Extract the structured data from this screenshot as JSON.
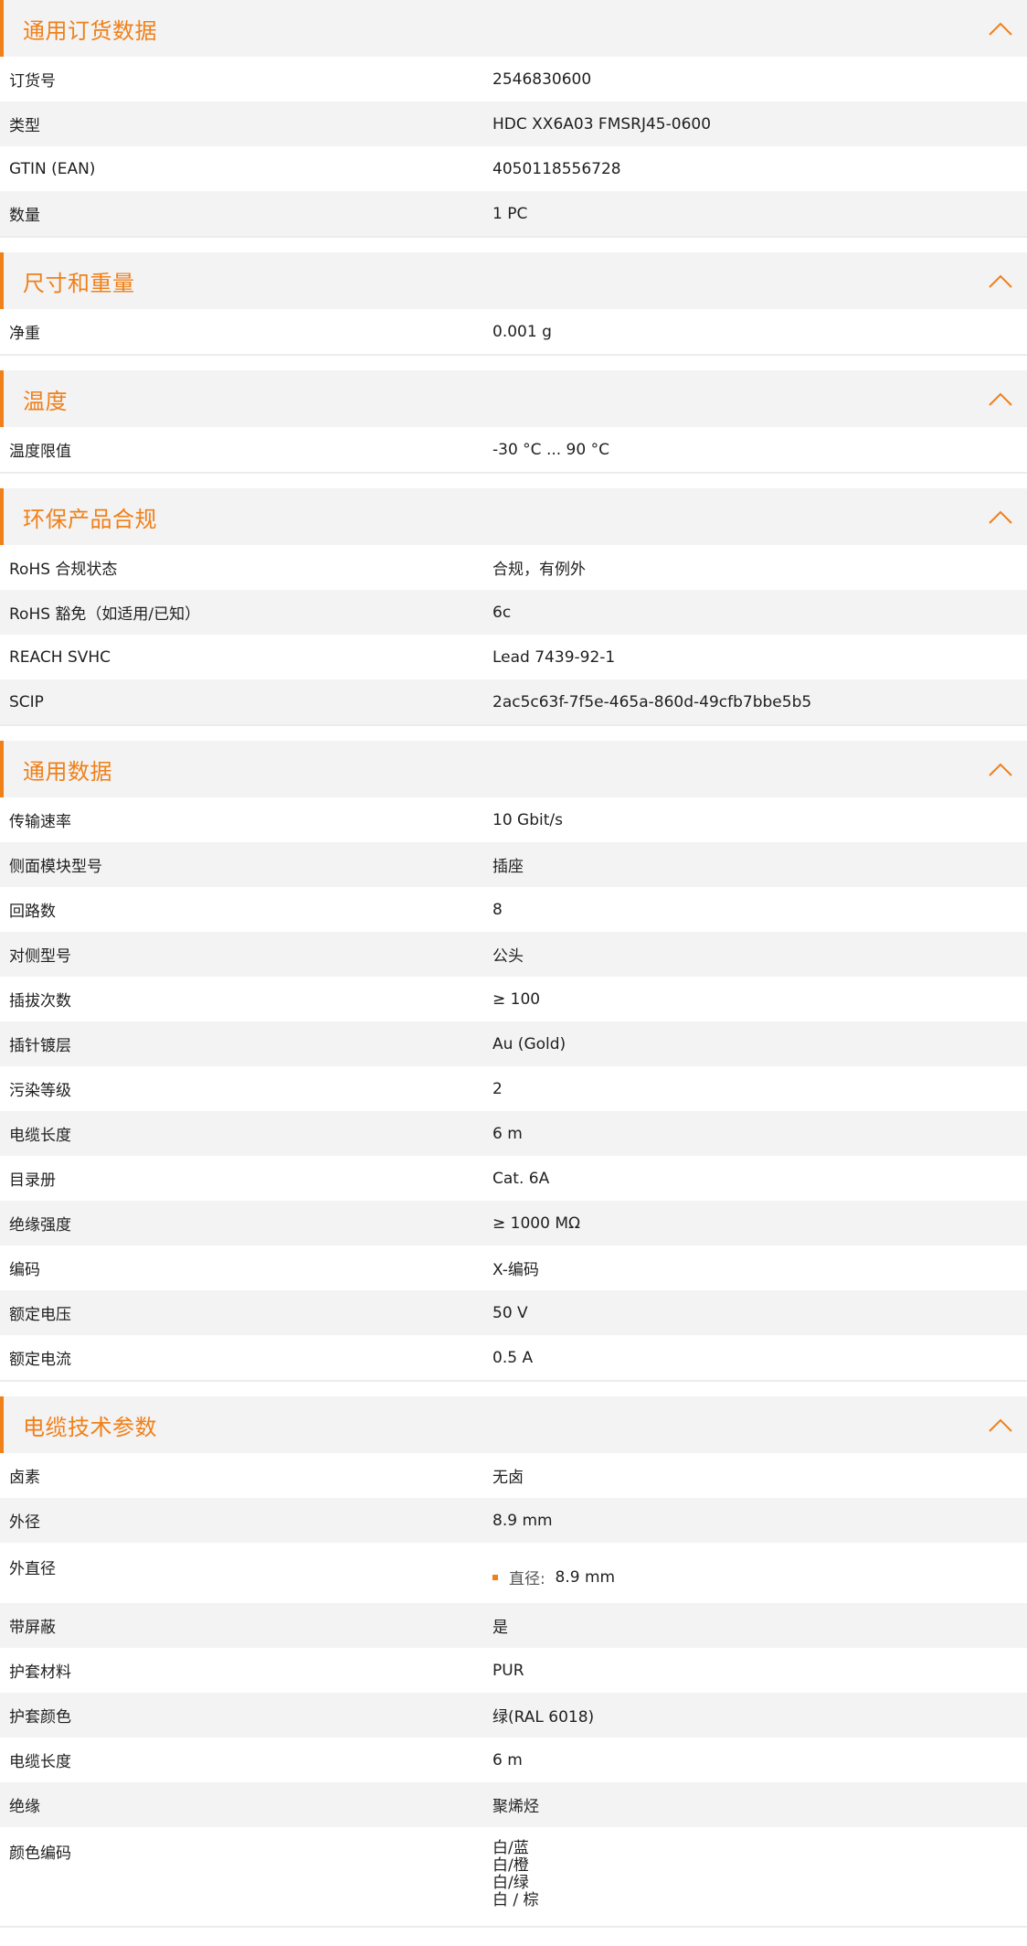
{
  "colors": {
    "accent": "#f08019",
    "header_bg": "#f3f3f4",
    "alt_row_bg": "#f3f3f4"
  },
  "icons": {
    "collapse": "chevron-up-icon",
    "list_bullet": "square-bullet-icon"
  },
  "sections": [
    {
      "title": "通用订货数据",
      "rows": [
        {
          "k": "订货号",
          "v": "2546830600"
        },
        {
          "k": "类型",
          "v": "HDC XX6A03 FMSRJ45-0600"
        },
        {
          "k": "GTIN (EAN)",
          "v": "4050118556728"
        },
        {
          "k": "数量",
          "v": "1  PC"
        }
      ]
    },
    {
      "title": "尺寸和重量",
      "rows": [
        {
          "k": "净重",
          "v": "0.001  g"
        }
      ]
    },
    {
      "title": "温度",
      "rows": [
        {
          "k": "温度限值",
          "v": "-30 °C ... 90 °C"
        }
      ]
    },
    {
      "title": "环保产品合规",
      "rows": [
        {
          "k": "RoHS 合规状态",
          "v": "合规，有例外"
        },
        {
          "k": "RoHS 豁免（如适用/已知）",
          "v": "6c"
        },
        {
          "k": "REACH SVHC",
          "v": "Lead 7439-92-1"
        },
        {
          "k": "SCIP",
          "v": "2ac5c63f-7f5e-465a-860d-49cfb7bbe5b5"
        }
      ]
    },
    {
      "title": "通用数据",
      "rows": [
        {
          "k": "传输速率",
          "v": "10 Gbit/s"
        },
        {
          "k": "侧面模块型号",
          "v": "插座"
        },
        {
          "k": "回路数",
          "v": "8"
        },
        {
          "k": "对侧型号",
          "v": "公头"
        },
        {
          "k": "插拔次数",
          "v": "≥ 100"
        },
        {
          "k": "插针镀层",
          "v": "Au (Gold)"
        },
        {
          "k": "污染等级",
          "v": "2"
        },
        {
          "k": "电缆长度",
          "v": "6  m"
        },
        {
          "k": "目录册",
          "v": "Cat. 6A"
        },
        {
          "k": "绝缘强度",
          "v": "≥ 1000 MΩ"
        },
        {
          "k": "编码",
          "v": "X-编码"
        },
        {
          "k": "额定电压",
          "v": "50  V"
        },
        {
          "k": "额定电流",
          "v": "0.5  A"
        }
      ]
    },
    {
      "title": "电缆技术参数",
      "rows": [
        {
          "k": "卤素",
          "v": "无卤"
        },
        {
          "k": "外径",
          "v": "8.9 mm"
        },
        {
          "k": "外直径",
          "v_label": "直径:",
          "v_value": "8.9 mm"
        },
        {
          "k": "带屏蔽",
          "v": "是"
        },
        {
          "k": "护套材料",
          "v": "PUR"
        },
        {
          "k": "护套颜色",
          "v": "绿(RAL 6018)"
        },
        {
          "k": "电缆长度",
          "v": "6  m"
        },
        {
          "k": "绝缘",
          "v": "聚烯烃"
        },
        {
          "k": "颜色编码",
          "v_lines": [
            "白/蓝",
            "白/橙",
            "白/绿",
            "白 / 棕"
          ]
        }
      ]
    }
  ]
}
